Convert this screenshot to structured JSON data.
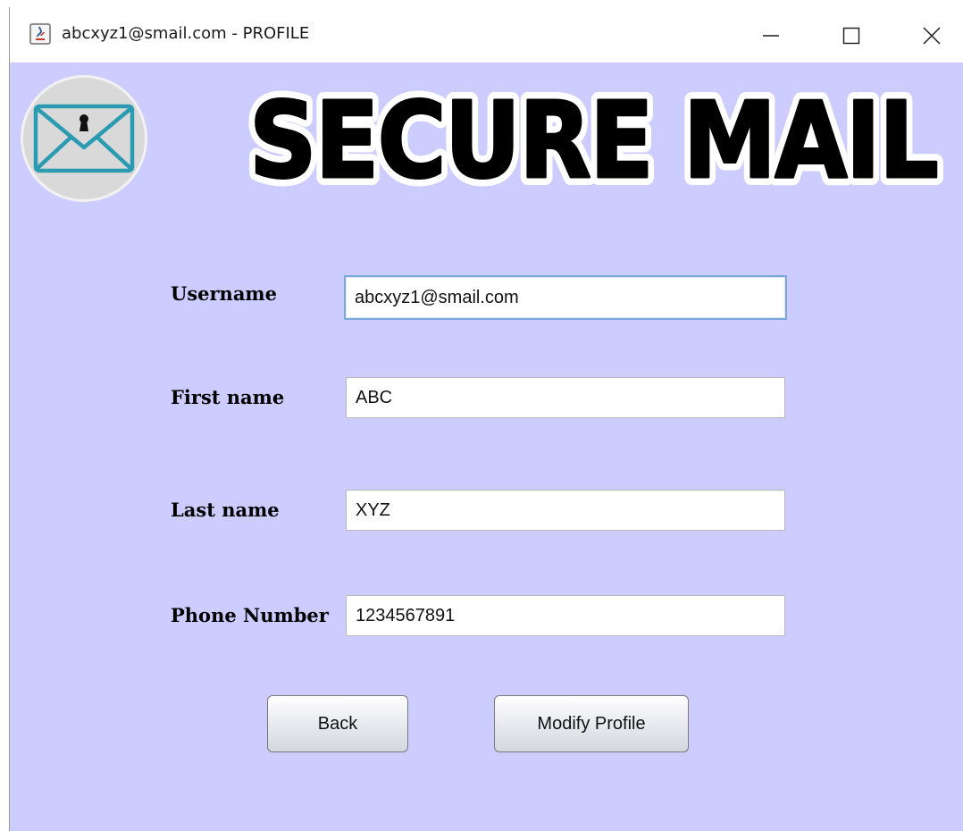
{
  "window": {
    "title": "abcxyz1@smail.com - PROFILE",
    "controls": {
      "minimize_icon": "minimize-icon",
      "maximize_icon": "maximize-icon",
      "close_icon": "close-icon"
    }
  },
  "header": {
    "banner_text": "SECURE MAIL",
    "logo_icon": "lock-envelope-icon"
  },
  "form": {
    "username": {
      "label": "Username",
      "value": "abcxyz1@smail.com"
    },
    "first_name": {
      "label": "First name",
      "value": "ABC"
    },
    "last_name": {
      "label": "Last name",
      "value": "XYZ"
    },
    "phone": {
      "label": "Phone Number",
      "value": "1234567891"
    }
  },
  "actions": {
    "back_label": "Back",
    "modify_label": "Modify Profile"
  },
  "colors": {
    "content_bg": "#ccccff",
    "banner_fill": "#000000",
    "banner_outline": "#ffffff",
    "envelope_stroke": "#2a9bb0"
  }
}
